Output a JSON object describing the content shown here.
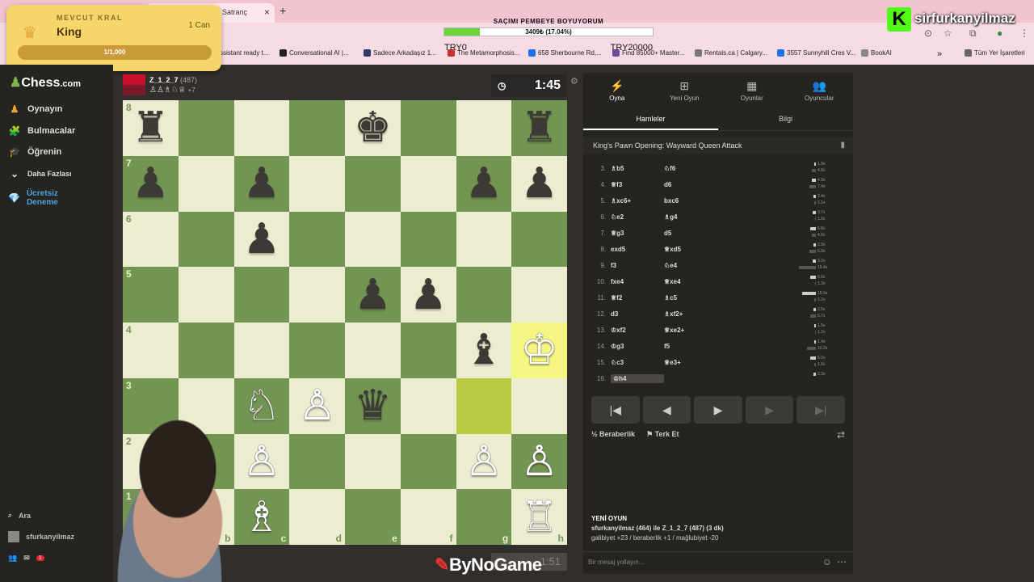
{
  "browser": {
    "tab_title": "Satranç",
    "tab_close": "×",
    "new_tab": "+",
    "bookmarks": [
      {
        "label": "ssistant ready t...",
        "color": "#8ab4f8"
      },
      {
        "label": "Conversational AI |...",
        "color": "#222222"
      },
      {
        "label": "Sadece Arkadaşız 1...",
        "color": "#2b3a6b"
      },
      {
        "label": "The Metamorphosis...",
        "color": "#c7302f"
      },
      {
        "label": "658 Sherbourne Rd,...",
        "color": "#1a73e8"
      },
      {
        "label": "Find 85000+ Master...",
        "color": "#6b4aa0"
      },
      {
        "label": "Rentals.ca | Calgary...",
        "color": "#777777"
      },
      {
        "label": "3557 Sunnyhill Cres V...",
        "color": "#1a73e8"
      },
      {
        "label": "BookAI",
        "color": "#888888"
      },
      {
        "label": "Tüm Yer İşaretleri",
        "color": "#666666"
      }
    ],
    "more": "»"
  },
  "stream_overlay": {
    "goal_title": "SAÇIMI PEMBEYE BOYUYORUM",
    "goal_value": "3409₺ (17.04%)",
    "goal_progress": 0.1704,
    "try_left": "TRY0",
    "try_right": "TRY20000",
    "king_label": "MEVCUT KRAL",
    "king_name": "King",
    "king_lives": "1 Can",
    "king_progress": "1/1,000",
    "streamer": "sirfurkanyilmaz",
    "kick_letter": "K",
    "watermark": "ByNoGame"
  },
  "sidebar": {
    "logo_a": "Chess",
    "logo_b": ".com",
    "items": [
      {
        "label": "Oynayın",
        "icon": "♟"
      },
      {
        "label": "Bulmacalar",
        "icon": "🧩"
      },
      {
        "label": "Öğrenin",
        "icon": "🎓"
      },
      {
        "label": "Daha Fazlası",
        "icon": "⌄"
      },
      {
        "label": "Ücretsiz Deneme",
        "icon": "💎"
      }
    ],
    "search_label": "Ara",
    "username": "sfurkanyilmaz",
    "notif_count": "1"
  },
  "opponent": {
    "name": "Z_1_2_7",
    "rating": "(487)",
    "captured": "♙♙♗♘♕",
    "advantage": "+7",
    "clock": "1:45"
  },
  "board": {
    "squares": [
      [
        "♜",
        "",
        "",
        "",
        "♚",
        "",
        "",
        "♜"
      ],
      [
        "♟",
        "",
        "♟",
        "",
        "",
        "",
        "♟",
        "♟"
      ],
      [
        "",
        "",
        "♟",
        "",
        "",
        "",
        "",
        ""
      ],
      [
        "",
        "",
        "",
        "",
        "♟",
        "♟",
        "",
        ""
      ],
      [
        "",
        "",
        "",
        "",
        "",
        "",
        "♝",
        "♔"
      ],
      [
        "",
        "",
        "♘",
        "♙",
        "♛",
        "",
        "",
        ""
      ],
      [
        "",
        "",
        "♙",
        "",
        "",
        "",
        "♙",
        "♙"
      ],
      [
        "",
        "",
        "♗",
        "",
        "",
        "",
        "",
        "♖"
      ]
    ],
    "files": [
      "a",
      "b",
      "c",
      "d",
      "e",
      "f",
      "g",
      "h"
    ],
    "ranks": [
      "8",
      "7",
      "6",
      "5",
      "4",
      "3",
      "2",
      "1"
    ],
    "ghost_clock": "1:51"
  },
  "panel": {
    "tabs": [
      {
        "label": "Oyna",
        "icon": "⚡"
      },
      {
        "label": "Yeni Oyun",
        "icon": "⊞"
      },
      {
        "label": "Oyunlar",
        "icon": "▦"
      },
      {
        "label": "Oyuncular",
        "icon": "👥"
      }
    ],
    "subtabs": [
      "Hamleler",
      "Bilgi"
    ],
    "opening": "King's Pawn Opening: Wayward Queen Attack",
    "moves": [
      {
        "n": "3.",
        "w": "♗b5",
        "b": "♘f6",
        "tw": "1.9s",
        "tb": "4.8s"
      },
      {
        "n": "4.",
        "w": "♕f3",
        "b": "d6",
        "tw": "4.9s",
        "tb": "7.4s"
      },
      {
        "n": "5.",
        "w": "♗xc6+",
        "b": "bxc6",
        "tw": "2.4s",
        "tb": "2.1s"
      },
      {
        "n": "6.",
        "w": "♘e2",
        "b": "♗g4",
        "tw": "3.7s",
        "tb": "1.0s"
      },
      {
        "n": "7.",
        "w": "♕g3",
        "b": "d5",
        "tw": "6.8s",
        "tb": "4.6s"
      },
      {
        "n": "8.",
        "w": "exd5",
        "b": "♕xd5",
        "tw": "2.9s",
        "tb": "6.9s"
      },
      {
        "n": "9.",
        "w": "f3",
        "b": "♘e4",
        "tw": "3.2s",
        "tb": "19.4s"
      },
      {
        "n": "10.",
        "w": "fxe4",
        "b": "♕xe4",
        "tw": "6.6s",
        "tb": "1.3s"
      },
      {
        "n": "11.",
        "w": "♕f2",
        "b": "♗c5",
        "tw": "15.9s",
        "tb": "2.2s"
      },
      {
        "n": "12.",
        "w": "d3",
        "b": "♗xf2+",
        "tw": "2.5s",
        "tb": "6.7s"
      },
      {
        "n": "13.",
        "w": "♔xf2",
        "b": "♕xe2+",
        "tw": "1.5s",
        "tb": "1.2s"
      },
      {
        "n": "14.",
        "w": "♔g3",
        "b": "f5",
        "tw": "1.4s",
        "tb": "10.2s"
      },
      {
        "n": "15.",
        "w": "♘c3",
        "b": "♕e3+",
        "tw": "6.2s",
        "tb": "1.6s"
      },
      {
        "n": "16.",
        "w": "♔h4",
        "b": "",
        "tw": "2.3s",
        "tb": ""
      }
    ],
    "controls": [
      "|◀",
      "◀",
      "▶",
      "▶",
      "▶|"
    ],
    "draw_label": "Beraberlik",
    "resign_label": "Terk Et",
    "new_game_title": "YENİ OYUN",
    "new_game_line": "sfurkanyilmaz (464) ile Z_1_2_7 (487) (3 dk)",
    "new_game_stats": "galibiyet +23 / beraberlik +1 / mağlubiyet -20",
    "chat_placeholder": "Bir mesaj yollayın..."
  }
}
